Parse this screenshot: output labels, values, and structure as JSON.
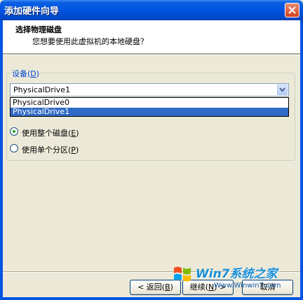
{
  "window": {
    "title": "添加硬件向导"
  },
  "header": {
    "title": "选择物理磁盘",
    "subtitle": "您想要使用此虚拟机的本地硬盘？"
  },
  "device_group": {
    "label_main": "设备(",
    "label_key": "D",
    "label_end": ")",
    "selected_value": "PhysicalDrive1",
    "options": [
      "PhysicalDrive0",
      "PhysicalDrive1"
    ]
  },
  "usage": {
    "whole_disk_main": "使用整个磁盘(",
    "whole_disk_key": "E",
    "whole_disk_end": ")",
    "whole_disk_checked": true,
    "partition_main": "使用单个分区(",
    "partition_key": "P",
    "partition_end": ")",
    "partition_checked": false
  },
  "buttons": {
    "back_main": "< 返回(",
    "back_key": "B",
    "back_end": ")",
    "next_main": "继续(",
    "next_key": "N",
    "next_end": ") >",
    "cancel": "取消"
  },
  "watermark": {
    "brand": "Win7系统之家",
    "url": "Www.Winwin7.com"
  },
  "colors": {
    "titlebar": "#0054e3",
    "selection": "#316ac5",
    "group_label": "#0046d5",
    "radio_dot": "#21a121"
  }
}
